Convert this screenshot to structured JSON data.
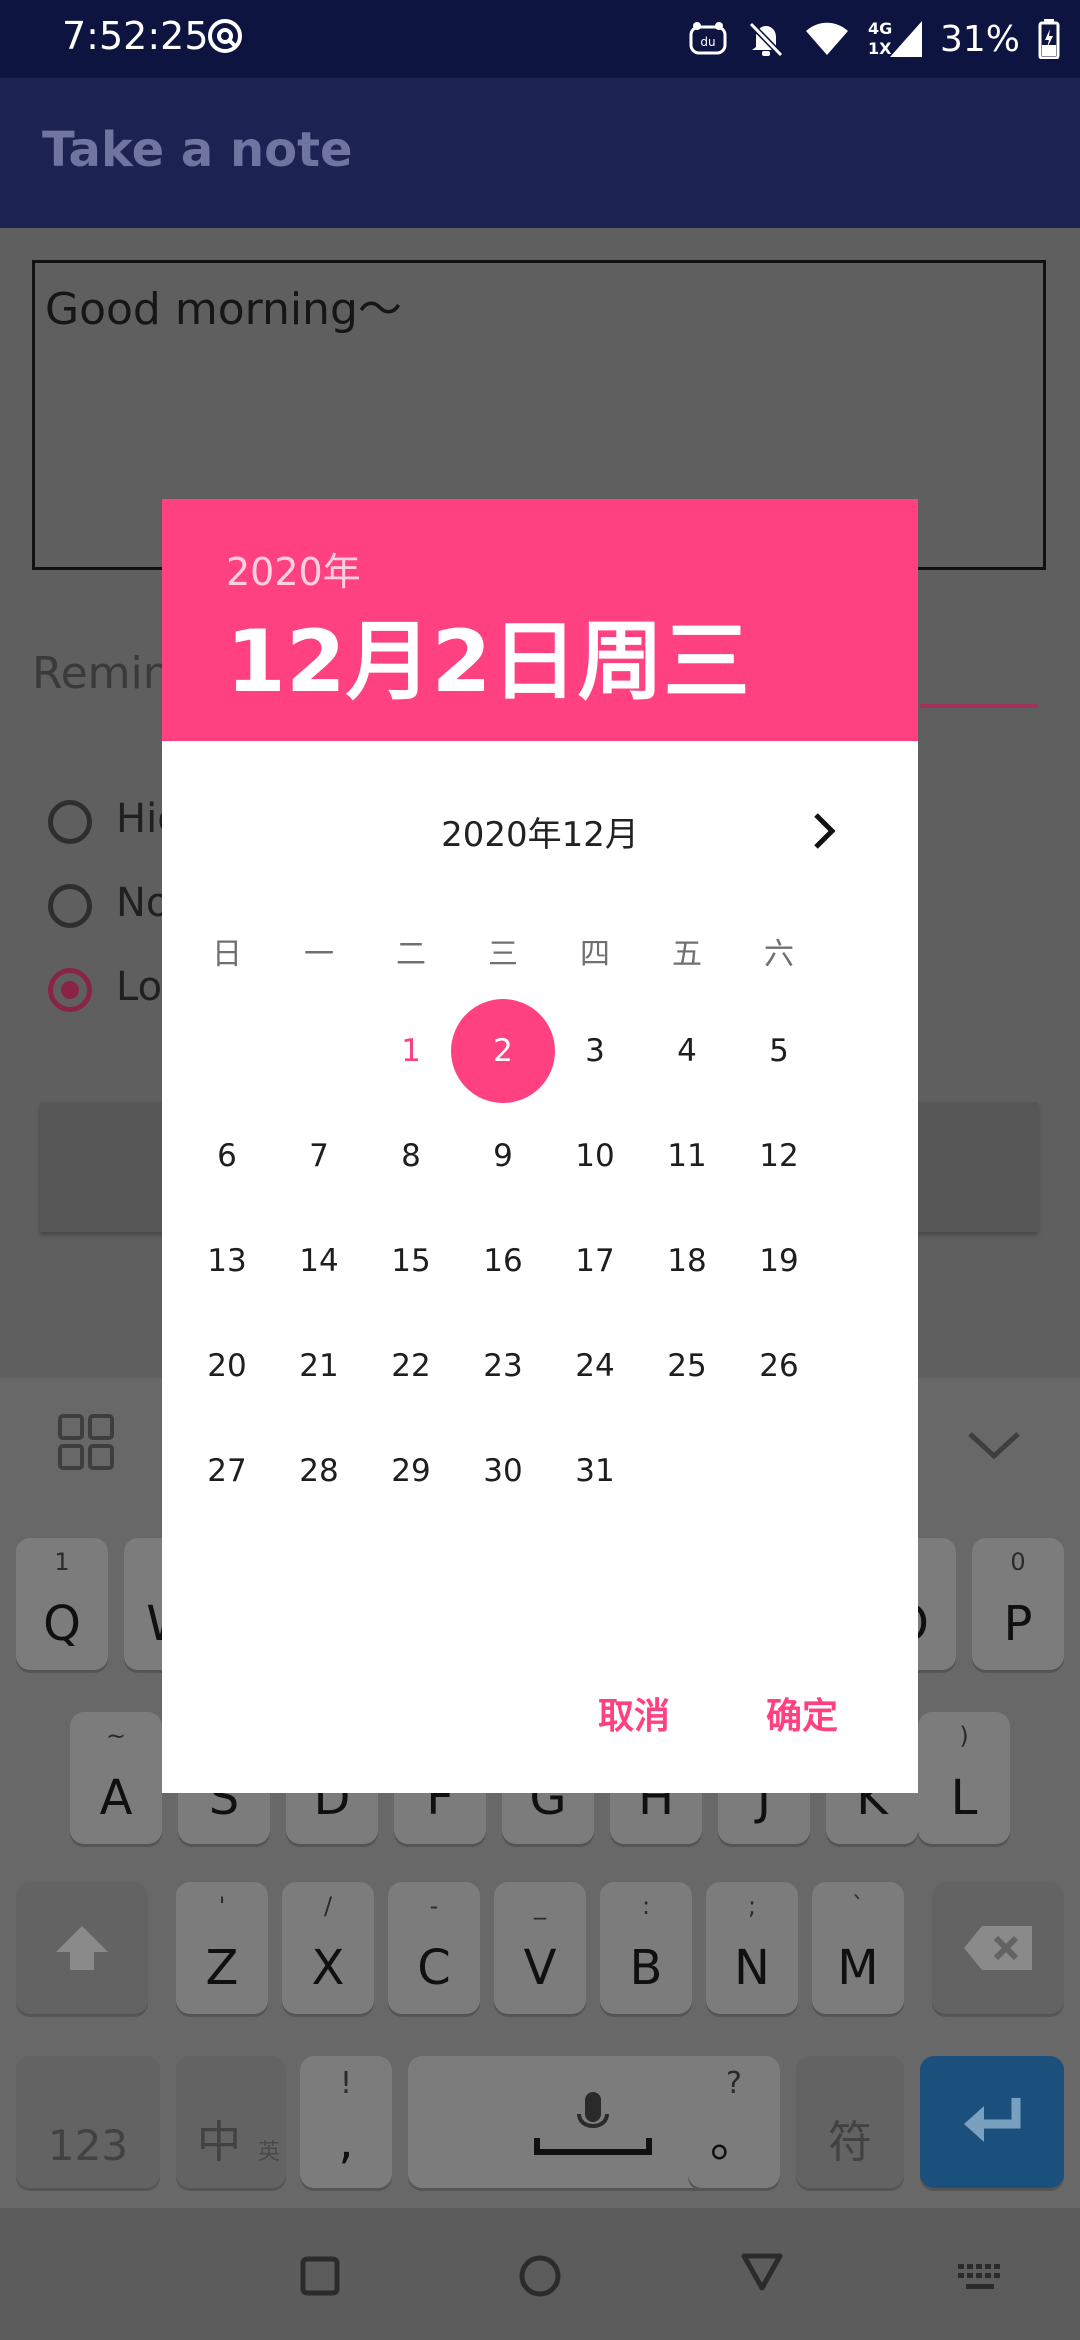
{
  "status_bar": {
    "time": "7:52:25",
    "network": "4G",
    "network_sub": "1X",
    "battery": "31%",
    "icons": [
      "do-not-disturb-icon",
      "du-app-icon",
      "bell-muted-icon",
      "wifi-icon",
      "signal-icon",
      "battery-icon"
    ]
  },
  "app_bar": {
    "title": "Take a note"
  },
  "note": {
    "text": "Good morning～"
  },
  "reminder": {
    "label_visible": "Remin"
  },
  "priority": {
    "options": [
      {
        "label_visible": "Hig",
        "checked": false
      },
      {
        "label_visible": "No",
        "checked": false
      },
      {
        "label_visible": "Lov",
        "checked": true
      }
    ]
  },
  "dialog": {
    "header_year": "2020年",
    "header_date": "12月2日周三",
    "month_title": "2020年12月",
    "weekdays": [
      "日",
      "一",
      "二",
      "三",
      "四",
      "五",
      "六"
    ],
    "days": [
      [
        "",
        "",
        "1",
        "2",
        "3",
        "4",
        "5"
      ],
      [
        "6",
        "7",
        "8",
        "9",
        "10",
        "11",
        "12"
      ],
      [
        "13",
        "14",
        "15",
        "16",
        "17",
        "18",
        "19"
      ],
      [
        "20",
        "21",
        "22",
        "23",
        "24",
        "25",
        "26"
      ],
      [
        "27",
        "28",
        "29",
        "30",
        "31",
        "",
        ""
      ]
    ],
    "selected_day": "2",
    "today_day": "1",
    "cancel_label": "取消",
    "ok_label": "确定",
    "accent_color": "#ff4081"
  },
  "keyboard": {
    "row1_visible": [
      {
        "label": "Q",
        "sub": "1"
      },
      {
        "label": "W",
        "sub": ""
      },
      {
        "label": "O",
        "sub": ""
      },
      {
        "label": "P",
        "sub": "0"
      }
    ],
    "row2_visible": [
      {
        "label": "A",
        "sub": "~"
      },
      {
        "label": "S",
        "sub": ""
      },
      {
        "label": "D",
        "sub": ""
      },
      {
        "label": "F",
        "sub": ""
      },
      {
        "label": "G",
        "sub": ""
      },
      {
        "label": "H",
        "sub": ""
      },
      {
        "label": "J",
        "sub": ""
      },
      {
        "label": "K",
        "sub": ""
      },
      {
        "label": "L",
        "sub": ")"
      }
    ],
    "row3": [
      {
        "label": "Z",
        "sub": "'"
      },
      {
        "label": "X",
        "sub": "/"
      },
      {
        "label": "C",
        "sub": "-"
      },
      {
        "label": "V",
        "sub": "_"
      },
      {
        "label": "B",
        "sub": ":"
      },
      {
        "label": "N",
        "sub": ";"
      },
      {
        "label": "M",
        "sub": "`"
      }
    ],
    "numbers_label": "123",
    "lang_label": "中",
    "lang_sub": "英",
    "comma_label": ",",
    "comma_sub": "!",
    "period_label": "。",
    "period_sub": "?",
    "symbol_label": "符"
  }
}
